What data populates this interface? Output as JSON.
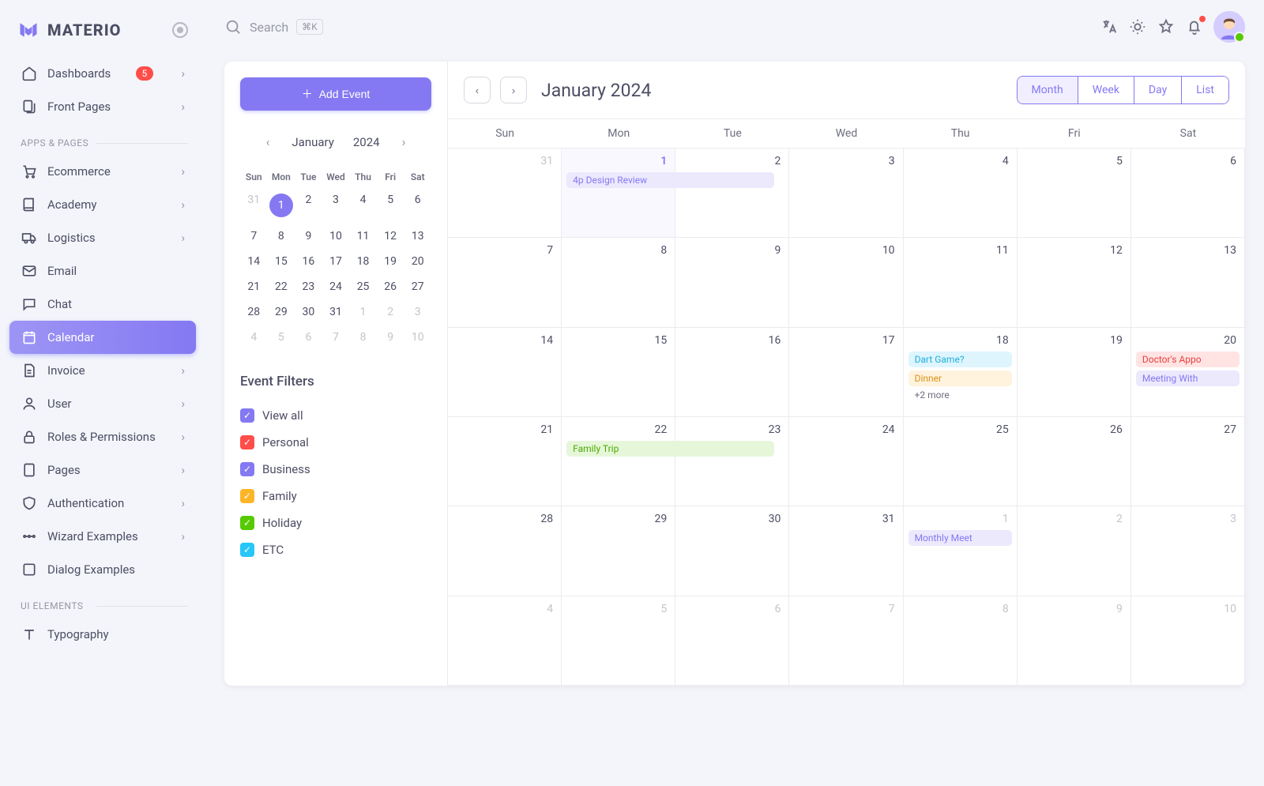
{
  "brand": "MATERIO",
  "search": {
    "placeholder": "Search",
    "shortcut": "⌘K"
  },
  "nav": {
    "dashboards": "Dashboards",
    "dashboards_badge": "5",
    "front_pages": "Front Pages",
    "section_apps": "APPS & PAGES",
    "ecommerce": "Ecommerce",
    "academy": "Academy",
    "logistics": "Logistics",
    "email": "Email",
    "chat": "Chat",
    "calendar": "Calendar",
    "invoice": "Invoice",
    "user": "User",
    "roles": "Roles & Permissions",
    "pages": "Pages",
    "auth": "Authentication",
    "wizard": "Wizard Examples",
    "dialog": "Dialog Examples",
    "section_ui": "UI ELEMENTS",
    "typography": "Typography"
  },
  "addEvent": "Add Event",
  "miniCal": {
    "month": "January",
    "year": "2024",
    "dow": [
      "Sun",
      "Mon",
      "Tue",
      "Wed",
      "Thu",
      "Fri",
      "Sat"
    ],
    "rows": [
      [
        {
          "d": "31",
          "m": 1
        },
        {
          "d": "1",
          "t": 1
        },
        {
          "d": "2"
        },
        {
          "d": "3"
        },
        {
          "d": "4"
        },
        {
          "d": "5"
        },
        {
          "d": "6"
        }
      ],
      [
        {
          "d": "7"
        },
        {
          "d": "8"
        },
        {
          "d": "9"
        },
        {
          "d": "10"
        },
        {
          "d": "11"
        },
        {
          "d": "12"
        },
        {
          "d": "13"
        }
      ],
      [
        {
          "d": "14"
        },
        {
          "d": "15"
        },
        {
          "d": "16"
        },
        {
          "d": "17"
        },
        {
          "d": "18"
        },
        {
          "d": "19"
        },
        {
          "d": "20"
        }
      ],
      [
        {
          "d": "21"
        },
        {
          "d": "22"
        },
        {
          "d": "23"
        },
        {
          "d": "24"
        },
        {
          "d": "25"
        },
        {
          "d": "26"
        },
        {
          "d": "27"
        }
      ],
      [
        {
          "d": "28"
        },
        {
          "d": "29"
        },
        {
          "d": "30"
        },
        {
          "d": "31"
        },
        {
          "d": "1",
          "m": 1
        },
        {
          "d": "2",
          "m": 1
        },
        {
          "d": "3",
          "m": 1
        }
      ],
      [
        {
          "d": "4",
          "m": 1
        },
        {
          "d": "5",
          "m": 1
        },
        {
          "d": "6",
          "m": 1
        },
        {
          "d": "7",
          "m": 1
        },
        {
          "d": "8",
          "m": 1
        },
        {
          "d": "9",
          "m": 1
        },
        {
          "d": "10",
          "m": 1
        }
      ]
    ]
  },
  "filtersTitle": "Event Filters",
  "filters": {
    "all": "View all",
    "personal": "Personal",
    "business": "Business",
    "family": "Family",
    "holiday": "Holiday",
    "etc": "ETC"
  },
  "bigCal": {
    "title": "January 2024",
    "views": {
      "month": "Month",
      "week": "Week",
      "day": "Day",
      "list": "List"
    },
    "dow": [
      "Sun",
      "Mon",
      "Tue",
      "Wed",
      "Thu",
      "Fri",
      "Sat"
    ],
    "events": {
      "designReview": "4p  Design Review",
      "dartGame": "Dart Game?",
      "dinner": "Dinner",
      "more2": "+2 more",
      "doctors": "Doctor's Appo",
      "meeting": "Meeting With",
      "familyTrip": "Family Trip",
      "monthly": "Monthly Meet"
    },
    "cells": [
      [
        {
          "n": "31",
          "m": 1
        },
        {
          "n": "1",
          "t": 1
        },
        {
          "n": "2"
        },
        {
          "n": "3"
        },
        {
          "n": "4"
        },
        {
          "n": "5"
        },
        {
          "n": "6"
        }
      ],
      [
        {
          "n": "7"
        },
        {
          "n": "8"
        },
        {
          "n": "9"
        },
        {
          "n": "10"
        },
        {
          "n": "11"
        },
        {
          "n": "12"
        },
        {
          "n": "13"
        }
      ],
      [
        {
          "n": "14"
        },
        {
          "n": "15"
        },
        {
          "n": "16"
        },
        {
          "n": "17"
        },
        {
          "n": "18"
        },
        {
          "n": "19"
        },
        {
          "n": "20"
        }
      ],
      [
        {
          "n": "21"
        },
        {
          "n": "22"
        },
        {
          "n": "23"
        },
        {
          "n": "24"
        },
        {
          "n": "25"
        },
        {
          "n": "26"
        },
        {
          "n": "27"
        }
      ],
      [
        {
          "n": "28"
        },
        {
          "n": "29"
        },
        {
          "n": "30"
        },
        {
          "n": "31"
        },
        {
          "n": "1",
          "m": 1
        },
        {
          "n": "2",
          "m": 1
        },
        {
          "n": "3",
          "m": 1
        }
      ],
      [
        {
          "n": "4",
          "m": 1
        },
        {
          "n": "5",
          "m": 1
        },
        {
          "n": "6",
          "m": 1
        },
        {
          "n": "7",
          "m": 1
        },
        {
          "n": "8",
          "m": 1
        },
        {
          "n": "9",
          "m": 1
        },
        {
          "n": "10",
          "m": 1
        }
      ]
    ]
  }
}
